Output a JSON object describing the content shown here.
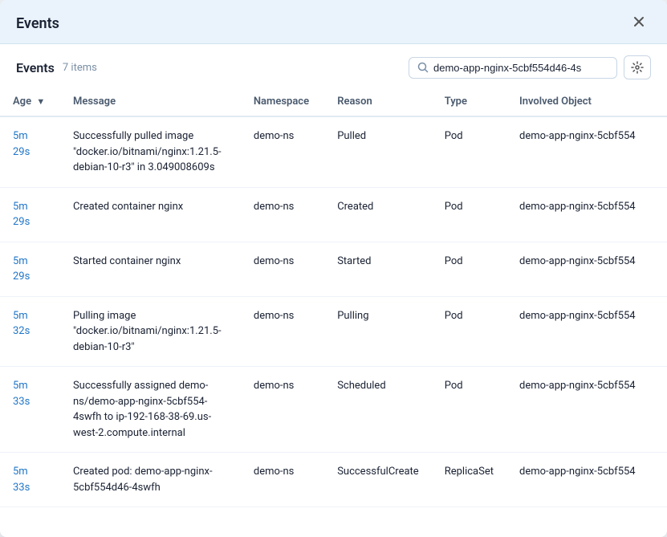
{
  "modal": {
    "title": "Events",
    "close_label": "×"
  },
  "toolbar": {
    "title": "Events",
    "item_count": "7 items",
    "search_value": "demo-app-nginx-5cbf554d46-4s",
    "search_placeholder": "Search..."
  },
  "columns": [
    {
      "id": "age",
      "label": "Age",
      "sortable": true,
      "sort_dir": "desc"
    },
    {
      "id": "message",
      "label": "Message",
      "sortable": false
    },
    {
      "id": "namespace",
      "label": "Namespace",
      "sortable": false
    },
    {
      "id": "reason",
      "label": "Reason",
      "sortable": false
    },
    {
      "id": "type",
      "label": "Type",
      "sortable": false
    },
    {
      "id": "involved_object",
      "label": "Involved Object",
      "sortable": false
    }
  ],
  "rows": [
    {
      "age": "5m 29s",
      "message": "Successfully pulled image \"docker.io/bitnami/nginx:1.21.5-debian-10-r3\" in 3.049008609s",
      "namespace": "demo-ns",
      "reason": "Pulled",
      "type": "Pod",
      "involved_object": "demo-app-nginx-5cbf554"
    },
    {
      "age": "5m 29s",
      "message": "Created container nginx",
      "namespace": "demo-ns",
      "reason": "Created",
      "type": "Pod",
      "involved_object": "demo-app-nginx-5cbf554"
    },
    {
      "age": "5m 29s",
      "message": "Started container nginx",
      "namespace": "demo-ns",
      "reason": "Started",
      "type": "Pod",
      "involved_object": "demo-app-nginx-5cbf554"
    },
    {
      "age": "5m 32s",
      "message": "Pulling image \"docker.io/bitnami/nginx:1.21.5-debian-10-r3\"",
      "namespace": "demo-ns",
      "reason": "Pulling",
      "type": "Pod",
      "involved_object": "demo-app-nginx-5cbf554"
    },
    {
      "age": "5m 33s",
      "message": "Successfully assigned demo-ns/demo-app-nginx-5cbf554-4swfh to ip-192-168-38-69.us-west-2.compute.internal",
      "namespace": "demo-ns",
      "reason": "Scheduled",
      "type": "Pod",
      "involved_object": "demo-app-nginx-5cbf554"
    },
    {
      "age": "5m 33s",
      "message": "Created pod: demo-app-nginx-5cbf554d46-4swfh",
      "namespace": "demo-ns",
      "reason": "SuccessfulCreate",
      "type": "ReplicaSet",
      "involved_object": "demo-app-nginx-5cbf554"
    }
  ]
}
